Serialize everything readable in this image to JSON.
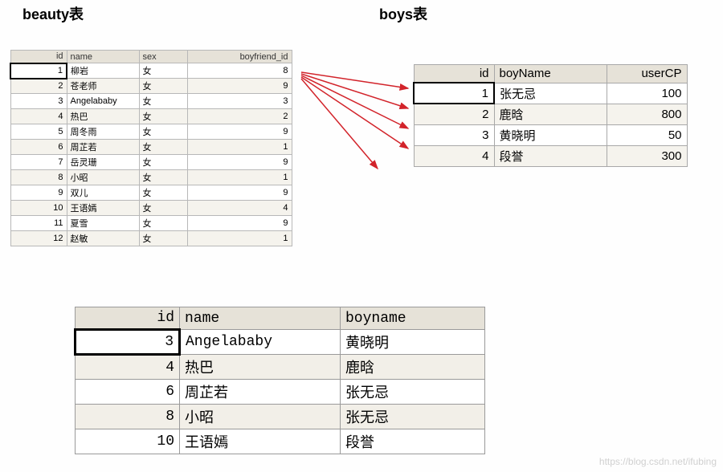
{
  "titles": {
    "beauty": "beauty表",
    "boys": "boys表"
  },
  "beauty_table": {
    "headers": [
      "id",
      "name",
      "sex",
      "boyfriend_id"
    ],
    "rows": [
      {
        "id": 1,
        "name": "柳岩",
        "sex": "女",
        "boyfriend_id": 8
      },
      {
        "id": 2,
        "name": "苍老师",
        "sex": "女",
        "boyfriend_id": 9
      },
      {
        "id": 3,
        "name": "Angelababy",
        "sex": "女",
        "boyfriend_id": 3
      },
      {
        "id": 4,
        "name": "热巴",
        "sex": "女",
        "boyfriend_id": 2
      },
      {
        "id": 5,
        "name": "周冬雨",
        "sex": "女",
        "boyfriend_id": 9
      },
      {
        "id": 6,
        "name": "周芷若",
        "sex": "女",
        "boyfriend_id": 1
      },
      {
        "id": 7,
        "name": "岳灵珊",
        "sex": "女",
        "boyfriend_id": 9
      },
      {
        "id": 8,
        "name": "小昭",
        "sex": "女",
        "boyfriend_id": 1
      },
      {
        "id": 9,
        "name": "双儿",
        "sex": "女",
        "boyfriend_id": 9
      },
      {
        "id": 10,
        "name": "王语嫣",
        "sex": "女",
        "boyfriend_id": 4
      },
      {
        "id": 11,
        "name": "夏雪",
        "sex": "女",
        "boyfriend_id": 9
      },
      {
        "id": 12,
        "name": "赵敏",
        "sex": "女",
        "boyfriend_id": 1
      }
    ]
  },
  "boys_table": {
    "headers": [
      "id",
      "boyName",
      "userCP"
    ],
    "rows": [
      {
        "id": 1,
        "boyName": "张无忌",
        "userCP": 100
      },
      {
        "id": 2,
        "boyName": "鹿晗",
        "userCP": 800
      },
      {
        "id": 3,
        "boyName": "黄晓明",
        "userCP": 50
      },
      {
        "id": 4,
        "boyName": "段誉",
        "userCP": 300
      }
    ]
  },
  "result_table": {
    "headers": [
      "id",
      "name",
      "boyname"
    ],
    "rows": [
      {
        "id": 3,
        "name": "Angelababy",
        "boyname": "黄晓明"
      },
      {
        "id": 4,
        "name": "热巴",
        "boyname": "鹿晗"
      },
      {
        "id": 6,
        "name": "周芷若",
        "boyname": "张无忌"
      },
      {
        "id": 8,
        "name": "小昭",
        "boyname": "张无忌"
      },
      {
        "id": 10,
        "name": "王语嫣",
        "boyname": "段誉"
      }
    ]
  },
  "watermark": "https://blog.csdn.net/ifubing"
}
